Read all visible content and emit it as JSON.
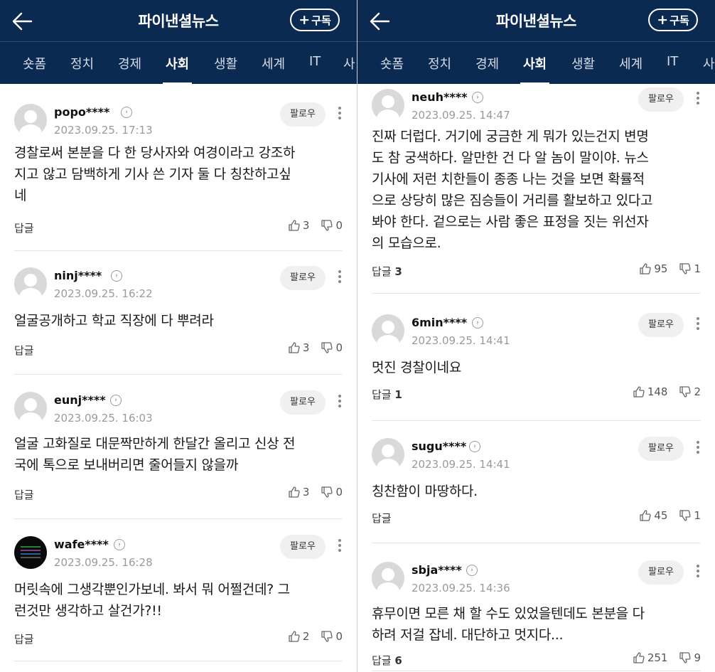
{
  "app": {
    "title": "파이낸셜뉴스",
    "subscribe_label": "구독"
  },
  "tabs": [
    "숏폼",
    "정치",
    "경제",
    "사회",
    "생활",
    "세계",
    "IT",
    "사"
  ],
  "active_tab": "사회",
  "icons": {
    "back": "arrow-left-icon",
    "like": "thumbs-up-icon",
    "dislike": "thumbs-down-icon",
    "more": "more-vertical-icon",
    "profile": "chevron-right-icon"
  },
  "colors": {
    "header_bg": "#0b2a52",
    "follow_bg": "#f0f0f0"
  },
  "follow_label": "팔로우",
  "left": {
    "comments": [
      {
        "nick": "popo****",
        "date": "2023.09.25. 17:13",
        "text_lines": [
          "경찰로써 본분을 다 한 당사자와 여경이라고 강조하",
          "지고 않고 담백하게 기사 쓴 기자 둘 다 칭찬하고싶",
          "네"
        ],
        "reply": "답글",
        "reply_count": "",
        "likes": "3",
        "dislikes": "0"
      },
      {
        "nick": "ninj****",
        "date": "2023.09.25. 16:22",
        "text_lines": [
          "얼굴공개하고 학교 직장에 다 뿌려라"
        ],
        "reply": "답글",
        "reply_count": "",
        "likes": "3",
        "dislikes": "0"
      },
      {
        "nick": "eunj****",
        "date": "2023.09.25. 16:03",
        "text_lines": [
          "얼굴 고화질로 대문짝만하게 한달간 올리고 신상 전",
          "국에 톡으로 보내버리면 줄어들지 않을까"
        ],
        "reply": "답글",
        "reply_count": "",
        "likes": "3",
        "dislikes": "0"
      },
      {
        "nick": "wafe****",
        "date": "2023.09.25. 16:28",
        "text_lines": [
          "머릿속에 그생각뿐인가보네. 봐서 뭐 어쩔건데? 그",
          "런것만 생각하고 살건가?!!"
        ],
        "reply": "답글",
        "reply_count": "",
        "likes": "2",
        "dislikes": "0"
      }
    ]
  },
  "right": {
    "comments": [
      {
        "nick": "neuh****",
        "date": "2023.09.25. 14:47",
        "text_lines": [
          "진짜 더럽다. 거기에 궁금한 게 뭐가 있는건지 변명",
          "도 참 궁색하다. 알만한 건 다 알 놈이 말이야. 뉴스",
          "기사에 저런 치한들이 종종 나는 것을 보면 확률적",
          "으로 상당히 많은 짐승들이 거리를 활보하고 있다고",
          "봐야 한다. 겉으로는 사람 좋은 표정을 짓는 위선자",
          "의 모습으로."
        ],
        "reply": "답글",
        "reply_count": "3",
        "likes": "95",
        "dislikes": "1"
      },
      {
        "nick": "6min****",
        "date": "2023.09.25. 14:41",
        "text_lines": [
          "멋진 경찰이네요"
        ],
        "reply": "답글",
        "reply_count": "1",
        "likes": "148",
        "dislikes": "2"
      },
      {
        "nick": "sugu****",
        "date": "2023.09.25. 14:41",
        "text_lines": [
          "칭찬함이 마땅하다."
        ],
        "reply": "답글",
        "reply_count": "",
        "likes": "45",
        "dislikes": "1"
      },
      {
        "nick": "sbja****",
        "date": "2023.09.25. 14:36",
        "text_lines": [
          "휴무이면 모른 채 할 수도 있었을텐데도 본분을 다",
          "하려 저걸 잡네. 대단하고 멋지다..."
        ],
        "reply": "답글",
        "reply_count": "6",
        "likes": "251",
        "dislikes": "9"
      }
    ]
  }
}
